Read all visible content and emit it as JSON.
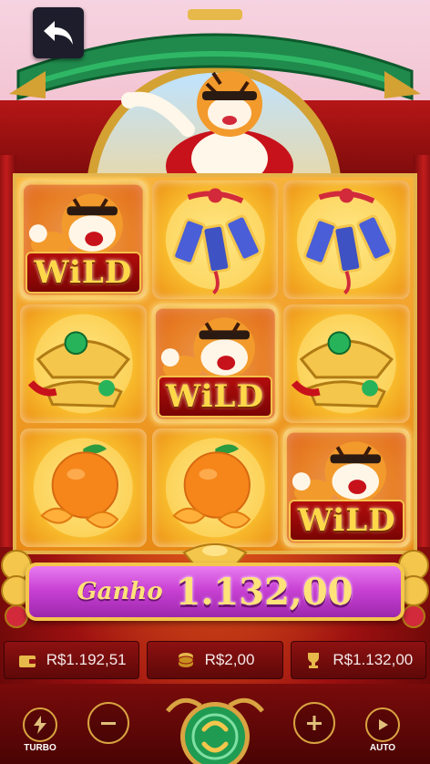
{
  "header": {
    "back_button_icon": "back-arrow-icon"
  },
  "reels": [
    [
      {
        "symbol": "wild-tiger",
        "label": "WiLD"
      },
      {
        "symbol": "gold-ingot-jade",
        "label": ""
      },
      {
        "symbol": "tangerines",
        "label": ""
      }
    ],
    [
      {
        "symbol": "firecrackers",
        "label": ""
      },
      {
        "symbol": "wild-tiger",
        "label": "WiLD"
      },
      {
        "symbol": "tangerines",
        "label": ""
      }
    ],
    [
      {
        "symbol": "firecrackers",
        "label": ""
      },
      {
        "symbol": "gold-ingot-jade",
        "label": ""
      },
      {
        "symbol": "wild-tiger",
        "label": "WiLD"
      }
    ]
  ],
  "win": {
    "label": "Ganho",
    "amount": "1.132,00"
  },
  "info": {
    "balance": "R$1.192,51",
    "bet": "R$2,00",
    "last_win": "R$1.132,00"
  },
  "controls": {
    "turbo_label": "TURBO",
    "auto_label": "AUTO",
    "minus_icon": "minus-icon",
    "plus_icon": "plus-icon",
    "spin_icon": "spin-icon"
  },
  "colors": {
    "accent_gold": "#f4c64b",
    "win_bar": "#c942d4",
    "frame_red": "#9c1010"
  }
}
